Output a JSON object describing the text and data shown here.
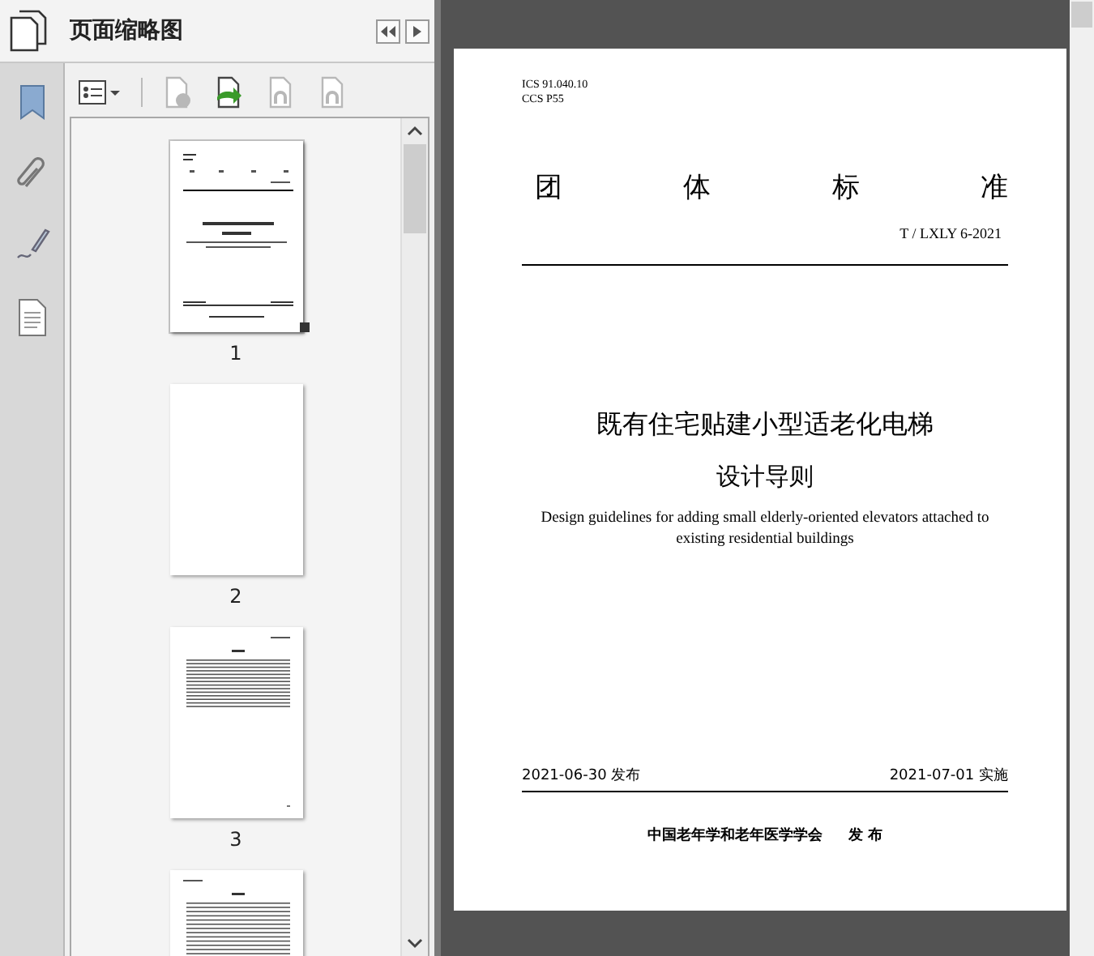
{
  "panel": {
    "title": "页面缩略图"
  },
  "toolbar": [
    {
      "kind": "options",
      "disabled": false
    },
    {
      "kind": "delete",
      "disabled": true
    },
    {
      "kind": "insert",
      "disabled": false
    },
    {
      "kind": "undo",
      "disabled": true
    },
    {
      "kind": "redo",
      "disabled": true
    }
  ],
  "thumbnails": [
    {
      "label": "1",
      "kind": "cover",
      "selected": true
    },
    {
      "label": "2",
      "kind": "blank",
      "selected": false
    },
    {
      "label": "3",
      "kind": "contents",
      "selected": false
    },
    {
      "kind": "text",
      "selected": false
    }
  ],
  "document": {
    "ics": "ICS 91.040.10",
    "ccs": "CCS P55",
    "heading": [
      "团",
      "体",
      "标",
      "准"
    ],
    "code": "T / LXLY 6-2021",
    "title": "既有住宅贴建小型适老化电梯",
    "subtitle": "设计导则",
    "english": "Design guidelines for adding small elderly-oriented elevators attached to existing residential buildings",
    "issued": "2021-06-30 发布",
    "effective": "2021-07-01 实施",
    "publisher": "中国老年学和老年医学学会",
    "published": "发 布"
  }
}
